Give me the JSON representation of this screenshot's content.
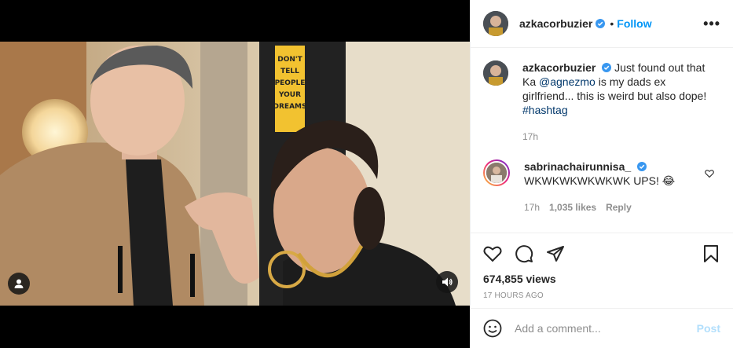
{
  "post": {
    "author": "azkacorbuzier",
    "follow_label": "Follow",
    "dot": "•",
    "more_label": "•••"
  },
  "caption": {
    "author": "azkacorbuzier",
    "text_before": " Just found out that Ka ",
    "mention": "@agnezmo",
    "text_after": " is my dads ex girlfriend... this is weird but also dope! ",
    "hashtag": "#hashtag",
    "time": "17h"
  },
  "comment": {
    "author": "sabrinachairunnisa_",
    "text": "WKWKWKWKWKWK UPS! 😂",
    "time": "17h",
    "likes": "1,035 likes",
    "reply_label": "Reply"
  },
  "stats": {
    "views": "674,855 views",
    "posted_ago": "17 HOURS AGO"
  },
  "composer": {
    "placeholder": "Add a comment...",
    "post_label": "Post"
  },
  "colors": {
    "accent": "#0095f6",
    "verified": "#3897f0",
    "post_disabled": "#b2dffc",
    "muted": "#8e8e8e"
  },
  "icons": [
    "user-tag-icon",
    "sound-icon",
    "verified-icon",
    "more-icon",
    "heart-icon",
    "comment-icon",
    "share-icon",
    "bookmark-icon",
    "emoji-icon"
  ]
}
